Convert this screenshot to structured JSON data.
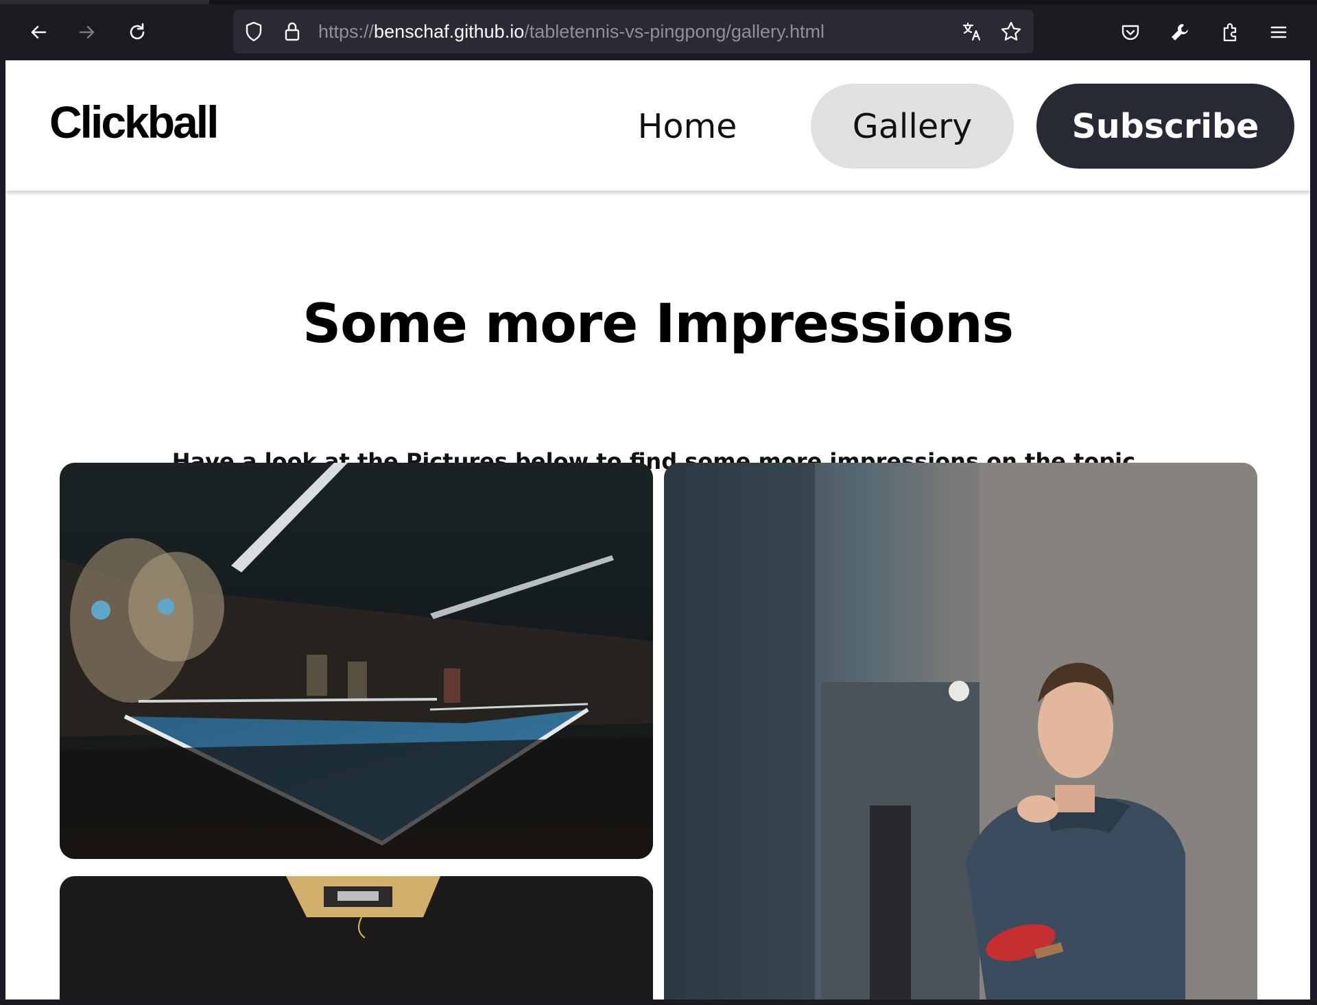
{
  "browser": {
    "url_scheme": "https://",
    "url_host": "benschaf.github.io",
    "url_path": "/tabletennis-vs-pingpong/gallery.html",
    "icons": [
      "back-arrow-icon",
      "forward-arrow-icon",
      "reload-icon",
      "shield-icon",
      "lock-icon",
      "translate-icon",
      "bookmark-star-icon",
      "pocket-icon",
      "wrench-icon",
      "extensions-icon",
      "menu-icon"
    ]
  },
  "header": {
    "logo": "Clickball",
    "nav": {
      "home": "Home",
      "gallery": "Gallery",
      "subscribe": "Subscribe"
    },
    "active_nav": "Gallery"
  },
  "main": {
    "title": "Some more Impressions",
    "subtitle": "Have a look at the Pictures below to find some more impressions on the topic."
  },
  "colors": {
    "nav_active_bg": "#e0e0e0",
    "subscribe_bg": "#272934",
    "table_blue": "#2f6d93"
  }
}
